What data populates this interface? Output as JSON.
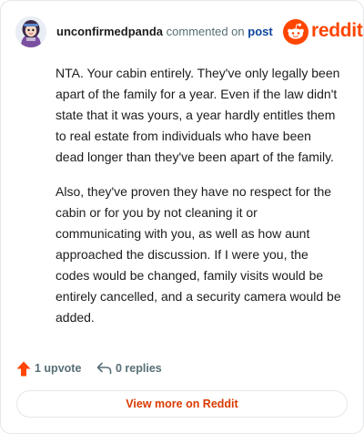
{
  "header": {
    "username": "unconfirmedpanda",
    "action_text": "commented on",
    "post_link": "post",
    "brand_name": "reddit",
    "brand_color": "#ff4500"
  },
  "comment": {
    "paragraphs": [
      "NTA. Your cabin entirely. They've only legally been apart of the family for a year. Even if the law didn't state that it was yours, a year hardly entitles them to real estate from individuals who have been dead longer than they've been apart of the family.",
      "Also, they've proven they have no respect for the cabin or for you by not cleaning it or communicating with you, as well as how aunt approached the discussion. If I were you, the codes would be changed, family visits would be entirely cancelled, and a security camera would be added."
    ]
  },
  "actions": {
    "upvote_icon": "upvote-arrow-icon",
    "upvote_label": "1 upvote",
    "reply_icon": "reply-arrow-icon",
    "replies_label": "0 replies"
  },
  "footer": {
    "view_more_label": "View more on Reddit"
  }
}
